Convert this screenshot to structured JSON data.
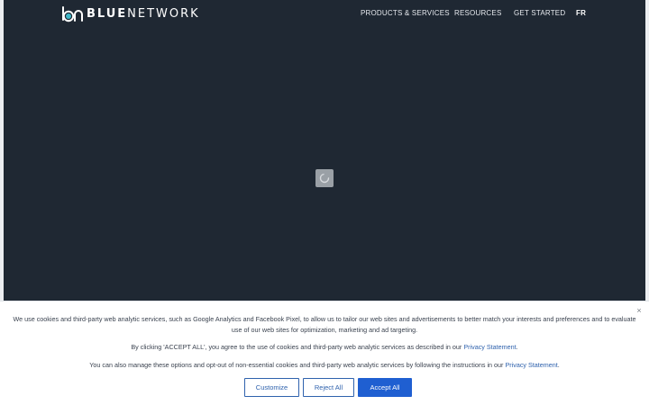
{
  "header": {
    "logo": {
      "part_bold": "BLUE",
      "part_light": "NETWORK"
    },
    "nav": [
      {
        "label": "PRODUCTS & SERVICES"
      },
      {
        "label": "RESOURCES"
      },
      {
        "label": "GET STARTED"
      },
      {
        "label": "FR"
      }
    ]
  },
  "cookie_banner": {
    "close_symbol": "×",
    "p1": "We use cookies and third-party web analytic services, such as Google Analytics and Facebook Pixel, to allow us to tailor our web sites and advertisements to better match your interests and preferences and to evaluate use of our web sites for optimization, marketing and ad targeting.",
    "p2_before": "By clicking 'ACCEPT ALL', you agree to the use of cookies and third-party web analytic services as described in our ",
    "p2_link": "Privacy Statement",
    "p2_after": ".",
    "p3_before": "You can also manage these options and opt-out of non-essential cookies and third-party web analytic services by following the instructions in our ",
    "p3_link": "Privacy Statement",
    "p3_after": ".",
    "buttons": {
      "customize": "Customize",
      "reject": "Reject All",
      "accept": "Accept All"
    }
  },
  "colors": {
    "hero_bg": "#1f2833",
    "accent_blue": "#1f5fd1",
    "link_blue": "#2f62ad",
    "logo_teal": "#3fb8c8"
  },
  "icons": [
    "blue-network-logo-icon",
    "loading-spinner-icon",
    "close-icon"
  ]
}
